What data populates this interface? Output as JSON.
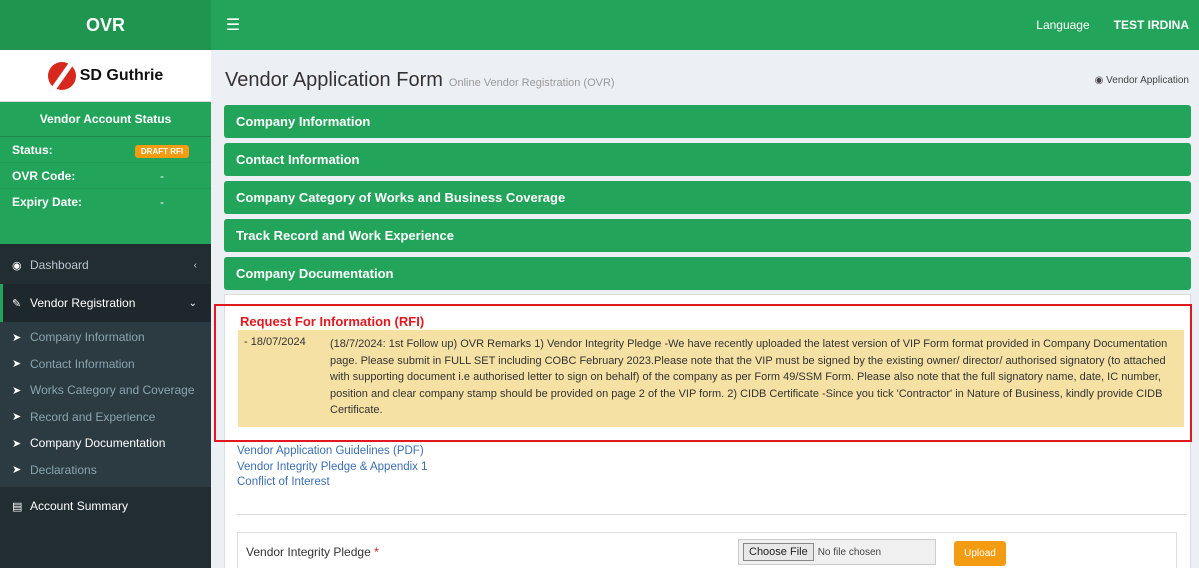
{
  "header": {
    "brand": "OVR",
    "menu_icon": "hamburger-icon",
    "language": "Language",
    "user": "TEST IRDINA"
  },
  "sidebar": {
    "logo_text": "SD Guthrie",
    "status_title": "Vendor Account Status",
    "status_rows": [
      {
        "label": "Status:",
        "value": "DRAFT RFI"
      },
      {
        "label": "OVR Code:",
        "value": "-"
      },
      {
        "label": "Expiry Date:",
        "value": "-"
      }
    ],
    "nav": {
      "dashboard": "Dashboard",
      "vendor_registration": "Vendor Registration",
      "account_summary": "Account Summary"
    },
    "sub_items": [
      "Company Information",
      "Contact Information",
      "Works Category and Coverage",
      "Record and Experience",
      "Company Documentation",
      "Declarations"
    ]
  },
  "page": {
    "title": "Vendor Application Form",
    "subtitle": "Online Vendor Registration (OVR)",
    "breadcrumb": "Vendor Application"
  },
  "panels": [
    "Company Information",
    "Contact Information",
    "Company Category of Works and Business Coverage",
    "Track Record and Work Experience",
    "Company Documentation"
  ],
  "rfi": {
    "title": "Request For Information (RFI)",
    "date": "- 18/07/2024",
    "text": "(18/7/2024: 1st Follow up) OVR Remarks 1) Vendor Integrity Pledge -We have recently uploaded the latest version of VIP Form format provided in Company Documentation page. Please submit in FULL SET including COBC February 2023.Please note that the VIP must be signed by the existing owner/ director/ authorised signatory (to attached with supporting document i.e authorised letter to sign on behalf) of the company as per Form 49/SSM Form. Please also note that the full signatory name, date, IC number, position and clear company stamp should be provided on page 2 of the VIP form. 2) CIDB Certificate -Since you tick 'Contractor' in Nature of Business, kindly provide CIDB Certificate."
  },
  "links": [
    "Vendor Application Guidelines (PDF)",
    "Vendor Integrity Pledge & Appendix 1",
    "Conflict of Interest"
  ],
  "upload": {
    "label": "Vendor Integrity Pledge",
    "required_mark": "*",
    "choose_file": "Choose File",
    "no_file": "No file chosen",
    "upload_btn": "Upload"
  }
}
